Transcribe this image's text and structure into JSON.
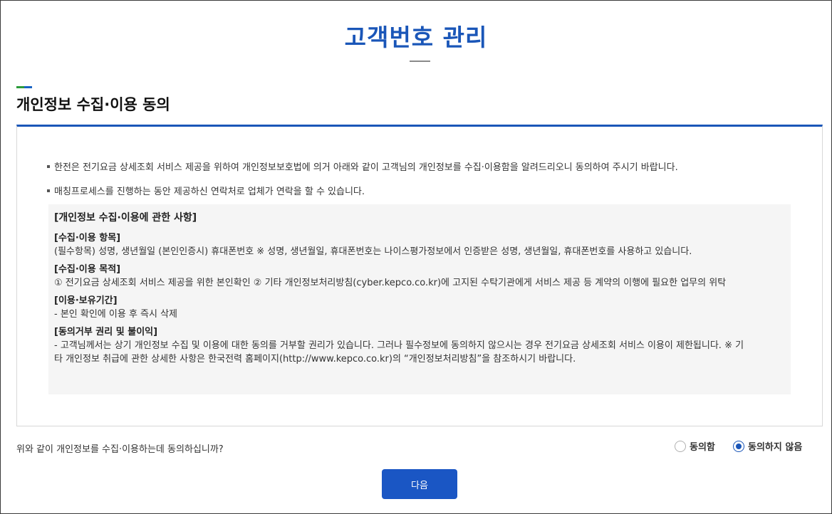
{
  "page": {
    "title": "고객번호 관리"
  },
  "section": {
    "title": "개인정보 수집·이용 동의"
  },
  "notices": [
    "한전은 전기요금 상세조회 서비스 제공을 위하여 개인정보보호법에 의거 아래와 같이 고객님의 개인정보를 수집·이용함을 알려드리오니 동의하여 주시기 바랍니다.",
    "매칭프로세스를 진행하는 동안 제공하신 연락처로 업체가 연락을 할 수 있습니다."
  ],
  "details": {
    "heading": "[개인정보 수집·이용에 관한 사항]",
    "items": [
      {
        "subtitle": "[수집·이용 항목]",
        "lines": [
          "(필수항목) 성명, 생년월일 (본인인증시) 휴대폰번호 ※ 성명, 생년월일, 휴대폰번호는 나이스평가정보에서 인증받은 성명, 생년월일, 휴대폰번호를 사용하고 있습니다."
        ]
      },
      {
        "subtitle": "[수집·이용 목적]",
        "lines": [
          "① 전기요금 상세조회 서비스 제공을 위한 본인확인 ② 기타 개인정보처리방침(cyber.kepco.co.kr)에 고지된 수탁기관에게 서비스 제공 등 계약의 이행에 필요한 업무의 위탁"
        ]
      },
      {
        "subtitle": "[이용·보유기간]",
        "lines": [
          "- 본인 확인에 이용 후 즉시 삭제"
        ]
      },
      {
        "subtitle": "[동의거부 권리 및 불이익]",
        "lines": [
          "- 고객님께서는 상기 개인정보 수집 및 이용에 대한 동의를 거부할 권리가 있습니다. 그러나 필수정보에 동의하지 않으시는 경우 전기요금 상세조회 서비스 이용이 제한됩니다. ※ 기",
          "타 개인정보 취급에 관한 상세한 사항은 한국전력 홈페이지(http://www.kepco.co.kr)의 “개인정보처리방침”을 참조하시기 바랍니다."
        ]
      }
    ]
  },
  "consent": {
    "question": "위와 같이 개인정보를 수집·이용하는데 동의하십니까?",
    "agree_label": "동의함",
    "disagree_label": "동의하지 않음",
    "selected": "disagree"
  },
  "next_button": {
    "label": "다음"
  },
  "colors": {
    "accent": "#1a56b8",
    "button": "#1a56c4",
    "detail_bg": "#f5f5f5",
    "accent_green": "#2b9b3a"
  }
}
